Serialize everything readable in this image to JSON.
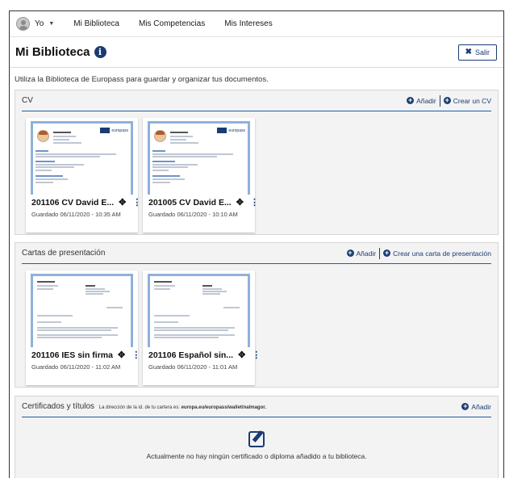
{
  "nav": {
    "user": "Yo",
    "links": [
      "Mi Biblioteca",
      "Mis Competencias",
      "Mis Intereses"
    ]
  },
  "header": {
    "title": "Mi Biblioteca",
    "exit_label": "Salir"
  },
  "intro": "Utiliza la Biblioteca de Europass para guardar y organizar tus documentos.",
  "cv": {
    "title": "CV",
    "add_label": "Añadir",
    "create_label": "Crear un CV",
    "cards": [
      {
        "title": "201106 CV David E...",
        "date": "Guardado 06/11/2020 - 10:35 AM"
      },
      {
        "title": "201005 CV David E...",
        "date": "Guardado 06/11/2020 - 10:10 AM"
      }
    ]
  },
  "letters": {
    "title": "Cartas de presentación",
    "add_label": "Añadir",
    "create_label": "Crear una carta de presentación",
    "cards": [
      {
        "title": "201106 IES sin firma",
        "date": "Guardado 06/11/2020 - 11:02 AM"
      },
      {
        "title": "201106 Español sin...",
        "date": "Guardado 06/11/2020 - 11:01 AM"
      }
    ]
  },
  "certificates": {
    "title": "Certificados y títulos",
    "note_prefix": "La dirección de la id. de tu cartera es:",
    "note_address": "europa.eu/europass/wallet/nalmagor.",
    "add_label": "Añadir",
    "empty_text": "Actualmente no hay ningún certificado o diploma añadido a tu biblioteca."
  },
  "thumb_brand": "europass",
  "colors": {
    "accent": "#1a3c73",
    "rule": "#1f5ca8",
    "thumb_border": "#8fb1dc"
  }
}
